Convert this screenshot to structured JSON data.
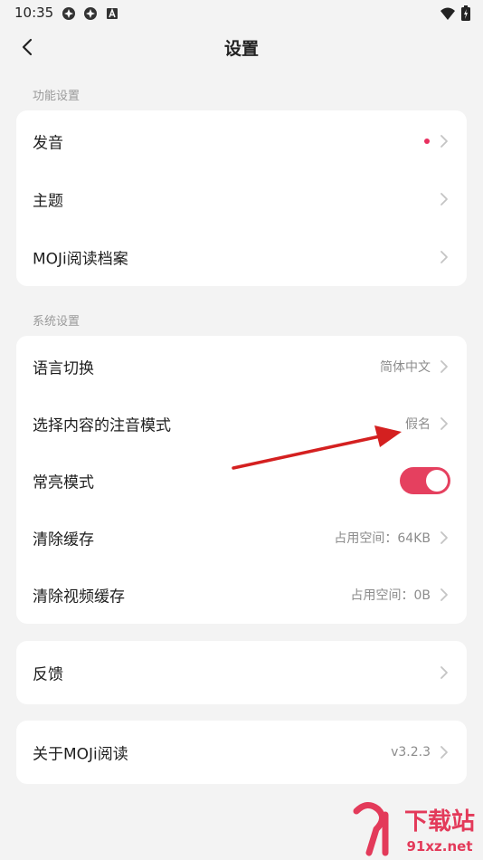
{
  "status_bar": {
    "time": "10:35"
  },
  "nav": {
    "title": "设置"
  },
  "sections": {
    "function_label": "功能设置",
    "system_label": "系统设置"
  },
  "function_items": [
    {
      "label": "发音"
    },
    {
      "label": "主题"
    },
    {
      "label": "MOJi阅读档案"
    }
  ],
  "system_items": [
    {
      "label": "语言切换",
      "value": "简体中文"
    },
    {
      "label": "选择内容的注音模式",
      "value": "假名"
    },
    {
      "label": "常亮模式",
      "toggle_on": true
    },
    {
      "label": "清除缓存",
      "value": "占用空间：64KB"
    },
    {
      "label": "清除视频缓存",
      "value": "占用空间：0B"
    }
  ],
  "feedback": {
    "label": "反馈"
  },
  "about": {
    "label": "关于MOJi阅读",
    "value": "v3.2.3"
  },
  "watermark": {
    "brand": "下载站",
    "domain": "91xz.net"
  },
  "colors": {
    "accent": "#e5405f",
    "background": "#f3f3f3",
    "card": "#ffffff",
    "arrow": "#d42020"
  }
}
